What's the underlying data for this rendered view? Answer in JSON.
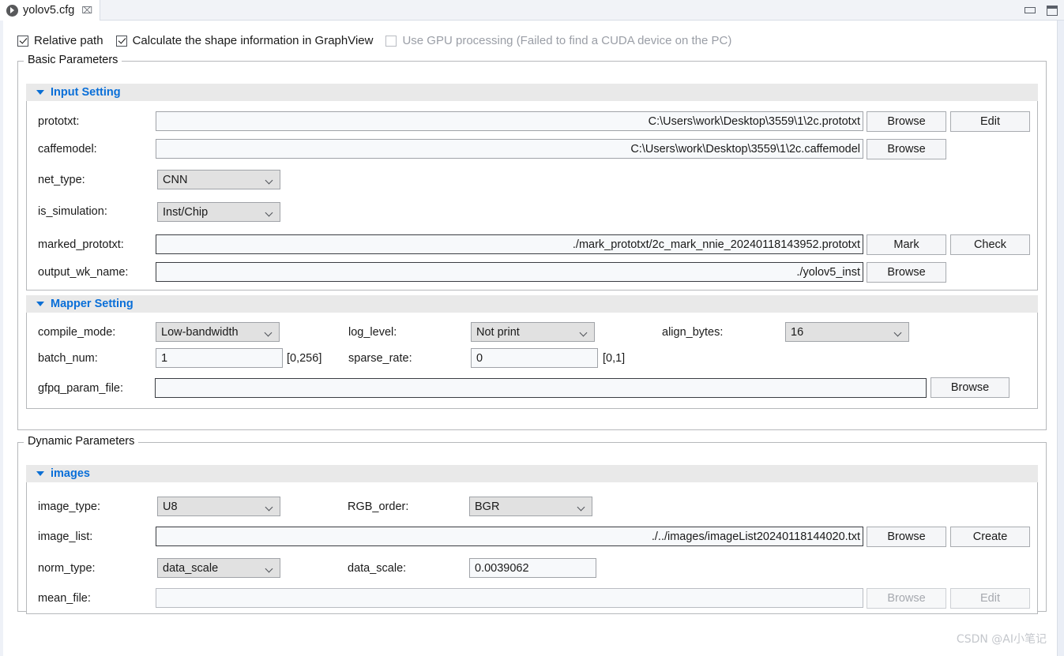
{
  "window": {
    "tab_title": "yolov5.cfg",
    "close_glyph": "⌧",
    "minimize_name": "minimize-button",
    "maximize_name": "maximize-button"
  },
  "options": {
    "relative_path": {
      "label": "Relative path",
      "checked": true,
      "enabled": true
    },
    "calc_shape": {
      "label": "Calculate the shape information in GraphView",
      "checked": true,
      "enabled": true
    },
    "use_gpu": {
      "label": "Use GPU processing (Failed to find a CUDA device on the PC)",
      "checked": false,
      "enabled": false
    }
  },
  "basic_parameters": {
    "legend": "Basic Parameters",
    "input_setting": {
      "title": "Input Setting",
      "rows": {
        "prototxt": {
          "label": "prototxt:",
          "value": "C:\\Users\\work\\Desktop\\3559\\1\\2c.prototxt",
          "buttons": [
            "Browse",
            "Edit"
          ]
        },
        "caffemodel": {
          "label": "caffemodel:",
          "value": "C:\\Users\\work\\Desktop\\3559\\1\\2c.caffemodel",
          "buttons": [
            "Browse"
          ]
        },
        "net_type": {
          "label": "net_type:",
          "value": "CNN"
        },
        "is_simulation": {
          "label": "is_simulation:",
          "value": "Inst/Chip"
        },
        "marked_prototxt": {
          "label": "marked_prototxt:",
          "value": "./mark_prototxt/2c_mark_nnie_20240118143952.prototxt",
          "buttons": [
            "Mark",
            "Check"
          ]
        },
        "output_wk_name": {
          "label": "output_wk_name:",
          "value": "./yolov5_inst",
          "buttons": [
            "Browse"
          ]
        }
      }
    },
    "mapper_setting": {
      "title": "Mapper Setting",
      "rows": {
        "compile_mode": {
          "label": "compile_mode:",
          "value": "Low-bandwidth"
        },
        "log_level": {
          "label": "log_level:",
          "value": "Not print"
        },
        "align_bytes": {
          "label": "align_bytes:",
          "value": "16"
        },
        "batch_num": {
          "label": "batch_num:",
          "value": "1",
          "range": "[0,256]"
        },
        "sparse_rate": {
          "label": "sparse_rate:",
          "value": "0",
          "range": "[0,1]"
        },
        "gfpq_param_file": {
          "label": "gfpq_param_file:",
          "value": "",
          "buttons": [
            "Browse"
          ]
        }
      }
    }
  },
  "dynamic_parameters": {
    "legend": "Dynamic Parameters",
    "images": {
      "title": "images",
      "rows": {
        "image_type": {
          "label": "image_type:",
          "value": "U8"
        },
        "rgb_order": {
          "label": "RGB_order:",
          "value": "BGR"
        },
        "image_list": {
          "label": "image_list:",
          "value": "./../images/imageList20240118144020.txt",
          "buttons": [
            "Browse",
            "Create"
          ]
        },
        "norm_type": {
          "label": "norm_type:",
          "value": "data_scale"
        },
        "data_scale": {
          "label": "data_scale:",
          "value": "0.0039062"
        },
        "mean_file": {
          "label": "mean_file:",
          "value": "",
          "buttons": [
            "Browse",
            "Edit"
          ],
          "enabled": false
        }
      }
    }
  },
  "watermark": "CSDN @AI小笔记",
  "colors": {
    "section_title": "#0a6fd8",
    "section_header_bg": "#e9e9e9",
    "combo_bg": "#e1e1e1",
    "input_bg": "#f7f9fb"
  }
}
